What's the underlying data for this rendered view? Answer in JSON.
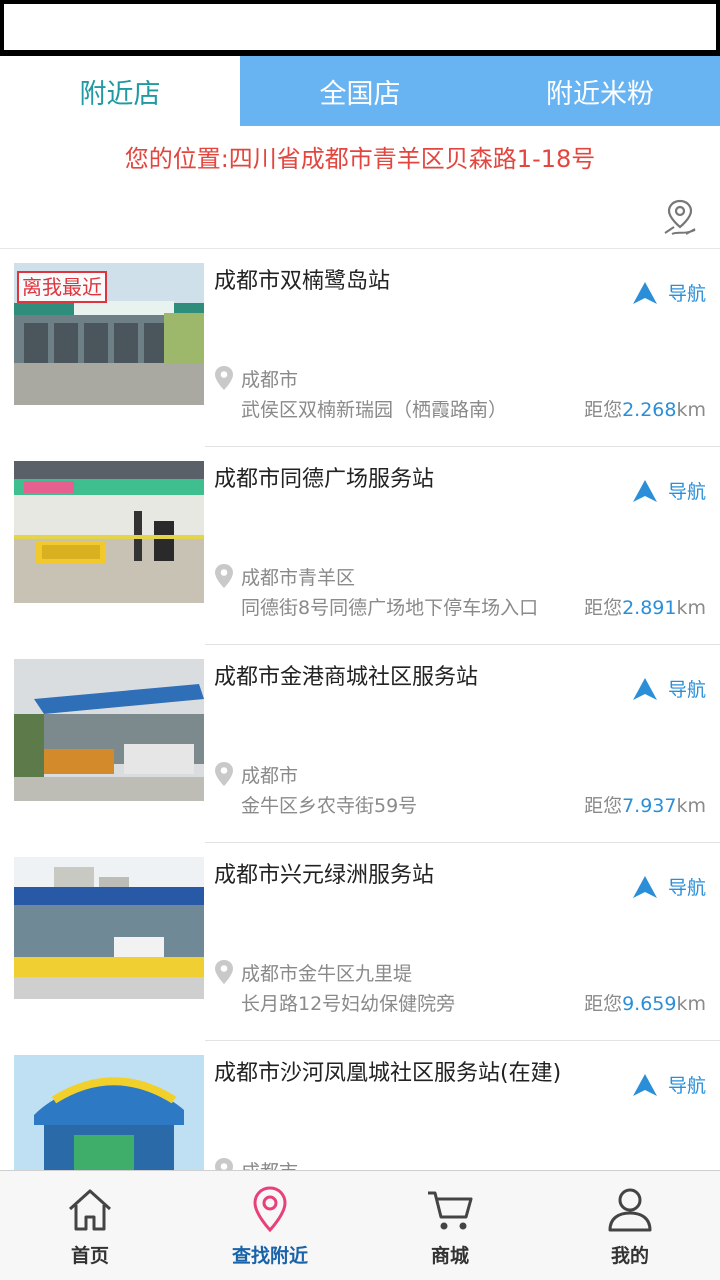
{
  "tabs": [
    {
      "label": "附近店",
      "active": true
    },
    {
      "label": "全国店",
      "active": false
    },
    {
      "label": "附近米粉",
      "active": false
    }
  ],
  "location": {
    "text": "您的位置:四川省成都市青羊区贝森路1-18号"
  },
  "nav_label": "导航",
  "dist_prefix": "距您",
  "dist_unit": "km",
  "stores": [
    {
      "name": "成都市双楠鹭岛站",
      "badge": "离我最近",
      "city": "成都市",
      "address": "武侯区双楠新瑞园（栖霞路南）",
      "distance": "2.268"
    },
    {
      "name": "成都市同德广场服务站",
      "city": "成都市青羊区",
      "address": "同德街8号同德广场地下停车场入口",
      "distance": "2.891"
    },
    {
      "name": "成都市金港商城社区服务站",
      "city": "成都市",
      "address": "金牛区乡农寺街59号",
      "distance": "7.937"
    },
    {
      "name": "成都市兴元绿洲服务站",
      "city": "成都市金牛区九里堤",
      "address": "长月路12号妇幼保健院旁",
      "distance": "9.659"
    },
    {
      "name": "成都市沙河凤凰城社区服务站(在建)",
      "city": "成都市",
      "address": "",
      "distance": ""
    }
  ],
  "bottom_nav": [
    {
      "label": "首页",
      "icon": "home-icon",
      "active": false
    },
    {
      "label": "查找附近",
      "icon": "location-pin-icon",
      "active": true
    },
    {
      "label": "商城",
      "icon": "cart-icon",
      "active": false
    },
    {
      "label": "我的",
      "icon": "user-icon",
      "active": false
    }
  ],
  "colors": {
    "tab_bar": "#68b3f2",
    "active_tab_text": "#1f9aa2",
    "location_text": "#e2463f",
    "nav_blue": "#2a8fd8",
    "badge_red": "#e0353d",
    "bottom_active": "#1a63a8",
    "pin_pink": "#e8407a"
  }
}
